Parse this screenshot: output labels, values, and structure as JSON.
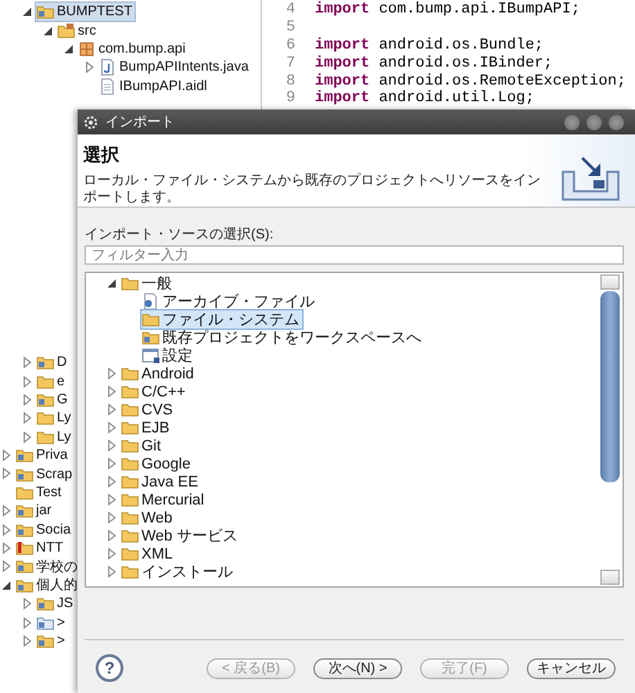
{
  "explorer": {
    "tree": [
      {
        "label": "BUMPTEST",
        "kind": "project",
        "expanded": true,
        "selected": true,
        "children": [
          {
            "label": "src",
            "kind": "source-folder",
            "expanded": true,
            "selected": false,
            "children": [
              {
                "label": "com.bump.api",
                "kind": "package",
                "expanded": true,
                "selected": false,
                "children": [
                  {
                    "label": "BumpAPIIntents.java",
                    "kind": "java-file",
                    "expanded": false,
                    "selected": false
                  },
                  {
                    "label": "IBumpAPI.aidl",
                    "kind": "file",
                    "selected": false
                  }
                ]
              }
            ]
          }
        ]
      }
    ],
    "partial_items": [
      {
        "label": "D",
        "kind": "project",
        "expanded": false,
        "selected": false
      },
      {
        "label": "e",
        "kind": "folder",
        "expanded": false,
        "selected": false
      },
      {
        "label": "G",
        "kind": "project",
        "expanded": false,
        "selected": false
      },
      {
        "label": "Ly",
        "kind": "folder",
        "expanded": false,
        "selected": false
      },
      {
        "label": "Ly",
        "kind": "folder",
        "expanded": false,
        "selected": false
      }
    ],
    "projects": [
      {
        "label": "Priva",
        "kind": "project",
        "expanded": false,
        "selected": false
      },
      {
        "label": "Scrap",
        "kind": "project",
        "expanded": false,
        "selected": false
      },
      {
        "label": "Test",
        "kind": "folder",
        "selected": false
      },
      {
        "label": "jar",
        "kind": "project",
        "expanded": false,
        "selected": false
      },
      {
        "label": "Socia",
        "kind": "project",
        "expanded": false,
        "selected": false
      },
      {
        "label": "NTT",
        "kind": "project-error",
        "expanded": false,
        "selected": false
      },
      {
        "label": "学校の",
        "kind": "project",
        "expanded": false,
        "selected": false
      },
      {
        "label": "個人的",
        "kind": "project",
        "expanded": true,
        "selected": false,
        "children": [
          {
            "label": "JS",
            "kind": "project",
            "expanded": false,
            "selected": false
          },
          {
            "label": ">",
            "kind": "project-unknown",
            "expanded": false,
            "selected": false
          },
          {
            "label": ">",
            "kind": "project",
            "expanded": false,
            "selected": false
          }
        ]
      }
    ]
  },
  "editor": {
    "lines": [
      {
        "number": "4",
        "keyword": "import",
        "code": "com.bump.api.IBumpAPI;"
      },
      {
        "number": "5"
      },
      {
        "number": "6",
        "keyword": "import",
        "code": "android.os.Bundle;"
      },
      {
        "number": "7",
        "keyword": "import",
        "code": "android.os.IBinder;"
      },
      {
        "number": "8",
        "keyword": "import",
        "code": "android.os.RemoteException;"
      },
      {
        "number": "9",
        "keyword": "import",
        "code": "android.util.Log;"
      }
    ]
  },
  "dialog": {
    "title": "インポート",
    "heading": "選択",
    "description": "ローカル・ファイル・システムから既存のプロジェクトへリソースをインポートします。",
    "source_label": "インポート・ソースの選択(S):",
    "filter": {
      "placeholder": "フィルター入力"
    },
    "tree": [
      {
        "label": "一般",
        "kind": "folder",
        "expanded": true,
        "selected": false,
        "children": [
          {
            "label": "アーカイブ・ファイル",
            "kind": "archive",
            "selected": false
          },
          {
            "label": "ファイル・システム",
            "kind": "folder",
            "selected": true
          },
          {
            "label": "既存プロジェクトをワークスペースへ",
            "kind": "project",
            "selected": false
          },
          {
            "label": "設定",
            "kind": "preferences",
            "selected": false
          }
        ]
      },
      {
        "label": "Android",
        "kind": "folder",
        "expanded": false,
        "selected": false
      },
      {
        "label": "C/C++",
        "kind": "folder",
        "expanded": false,
        "selected": false
      },
      {
        "label": "CVS",
        "kind": "folder",
        "expanded": false,
        "selected": false
      },
      {
        "label": "EJB",
        "kind": "folder",
        "expanded": false,
        "selected": false
      },
      {
        "label": "Git",
        "kind": "folder",
        "expanded": false,
        "selected": false
      },
      {
        "label": "Google",
        "kind": "folder",
        "expanded": false,
        "selected": false
      },
      {
        "label": "Java EE",
        "kind": "folder",
        "expanded": false,
        "selected": false
      },
      {
        "label": "Mercurial",
        "kind": "folder",
        "expanded": false,
        "selected": false
      },
      {
        "label": "Web",
        "kind": "folder",
        "expanded": false,
        "selected": false
      },
      {
        "label": "Web サービス",
        "kind": "folder",
        "expanded": false,
        "selected": false
      },
      {
        "label": "XML",
        "kind": "folder",
        "expanded": false,
        "selected": false
      },
      {
        "label": "インストール",
        "kind": "folder",
        "expanded": false,
        "selected": false
      }
    ],
    "help": "?",
    "buttons": [
      {
        "label": "< 戻る(B)",
        "disabled": true
      },
      {
        "label": "次へ(N) >",
        "disabled": false
      },
      {
        "label": "完了(F)",
        "disabled": true
      },
      {
        "label": "キャンセル",
        "disabled": false
      }
    ]
  }
}
